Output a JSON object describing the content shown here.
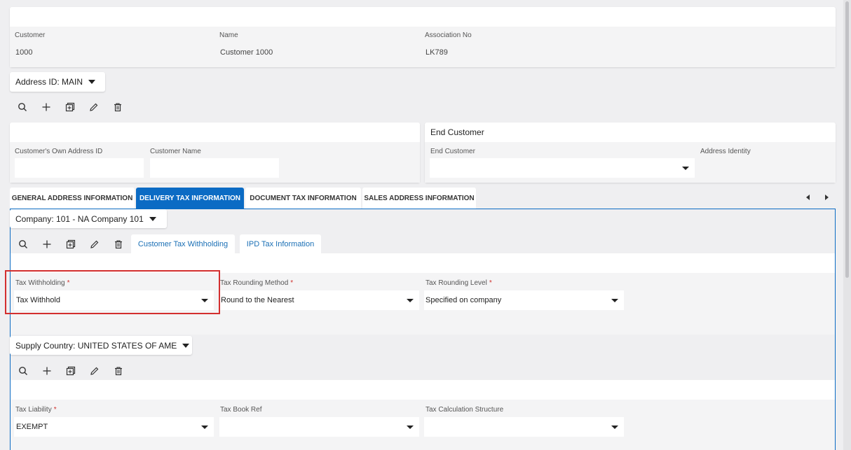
{
  "header": {
    "fields": [
      {
        "label": "Customer",
        "value": "1000"
      },
      {
        "label": "Name",
        "value": "Customer 1000"
      },
      {
        "label": "Association No",
        "value": "LK789"
      }
    ]
  },
  "address_selector": {
    "label": "Address ID: MAIN"
  },
  "own_address": {
    "fields": [
      {
        "label": "Customer's Own Address ID",
        "value": ""
      },
      {
        "label": "Customer Name",
        "value": ""
      }
    ]
  },
  "end_customer": {
    "title": "End Customer",
    "end_customer_label": "End Customer",
    "end_customer_value": "",
    "address_identity_label": "Address Identity"
  },
  "tabs": [
    {
      "label": "GENERAL ADDRESS INFORMATION",
      "active": false
    },
    {
      "label": "DELIVERY TAX INFORMATION",
      "active": true
    },
    {
      "label": "DOCUMENT TAX INFORMATION",
      "active": false
    },
    {
      "label": "SALES ADDRESS INFORMATION",
      "active": false
    }
  ],
  "company_selector": {
    "label": "Company: 101 - NA Company 101"
  },
  "sub_tabs": [
    {
      "label": "Customer Tax Withholding"
    },
    {
      "label": "IPD Tax Information"
    }
  ],
  "tax_fields": [
    {
      "label": "Tax Withholding",
      "value": "Tax Withhold",
      "required": "*"
    },
    {
      "label": "Tax Rounding Method",
      "value": "Round to the Nearest",
      "required": "*"
    },
    {
      "label": "Tax Rounding Level",
      "value": "Specified on company",
      "required": "*"
    }
  ],
  "supply_country_selector": {
    "label": "Supply Country: UNITED STATES OF AME"
  },
  "liability_fields": [
    {
      "label": "Tax Liability",
      "value": "EXEMPT",
      "required": "*"
    },
    {
      "label": "Tax Book Ref",
      "value": ""
    },
    {
      "label": "Tax Calculation Structure",
      "value": ""
    }
  ],
  "colors": {
    "accent": "#0b6bc4",
    "highlight": "#d32f2f",
    "required": "#d0312d"
  }
}
